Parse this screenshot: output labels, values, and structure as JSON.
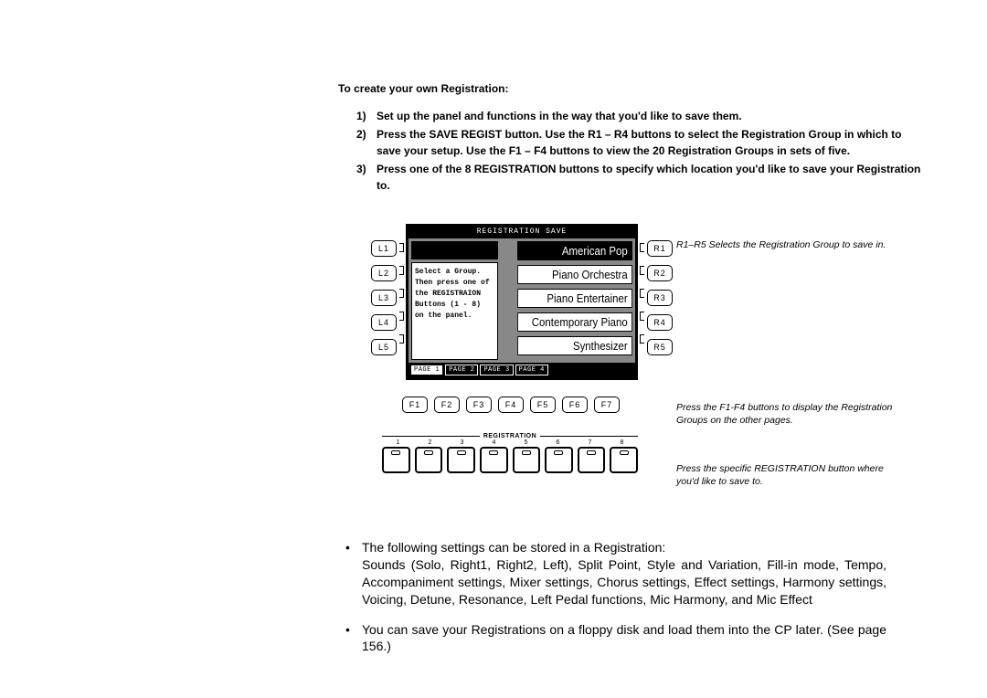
{
  "heading": "To create your own Registration:",
  "steps": [
    {
      "num": "1)",
      "text": "Set up the panel and functions in the way that you'd like to save them."
    },
    {
      "num": "2)",
      "text": "Press the SAVE REGIST button.  Use the R1 – R4 buttons to select the Registration Group in which to save your setup.  Use the F1 – F4 buttons to view the 20 Registration Groups in sets of five."
    },
    {
      "num": "3)",
      "text": "Press one of the 8 REGISTRATION buttons to specify which location you'd like to save your Registration to."
    }
  ],
  "side": {
    "L": [
      "L1",
      "L2",
      "L3",
      "L4",
      "L5"
    ],
    "R": [
      "R1",
      "R2",
      "R3",
      "R4",
      "R5"
    ]
  },
  "lcd": {
    "title": "REGISTRATION SAVE",
    "msg": [
      "Select a Group.",
      "Then press one of",
      "the REGISTRAION",
      "Buttons (1 - 8)",
      "on the panel."
    ],
    "items": [
      "American Pop",
      "Piano Orchestra",
      "Piano Entertainer",
      "Contemporary Piano",
      "Synthesizer"
    ],
    "pages": [
      "PAGE 1",
      "PAGE 2",
      "PAGE 3",
      "PAGE 4"
    ]
  },
  "fbtns": [
    "F1",
    "F2",
    "F3",
    "F4",
    "F5",
    "F6",
    "F7"
  ],
  "reg": {
    "label": "REGISTRATION",
    "nums": [
      "1",
      "2",
      "3",
      "4",
      "5",
      "6",
      "7",
      "8"
    ]
  },
  "anno": {
    "r": "R1–R5 Selects the Registration Group to save in.",
    "f": "Press the F1-F4 buttons to display the Registration Groups on the other pages.",
    "reg": "Press the specific REGISTRATION button where you'd like to save to."
  },
  "bullets": [
    "The following settings can be stored in a Registration:\nSounds (Solo, Right1, Right2, Left), Split Point, Style and Variation, Fill-in mode, Tempo, Accompaniment settings, Mixer settings, Chorus settings, Effect settings, Harmony settings, Voicing, Detune, Resonance, Left Pedal functions, Mic Harmony, and Mic Effect",
    "You can save your Registrations on a floppy disk and load them into the CP later. (See page 156.)"
  ]
}
